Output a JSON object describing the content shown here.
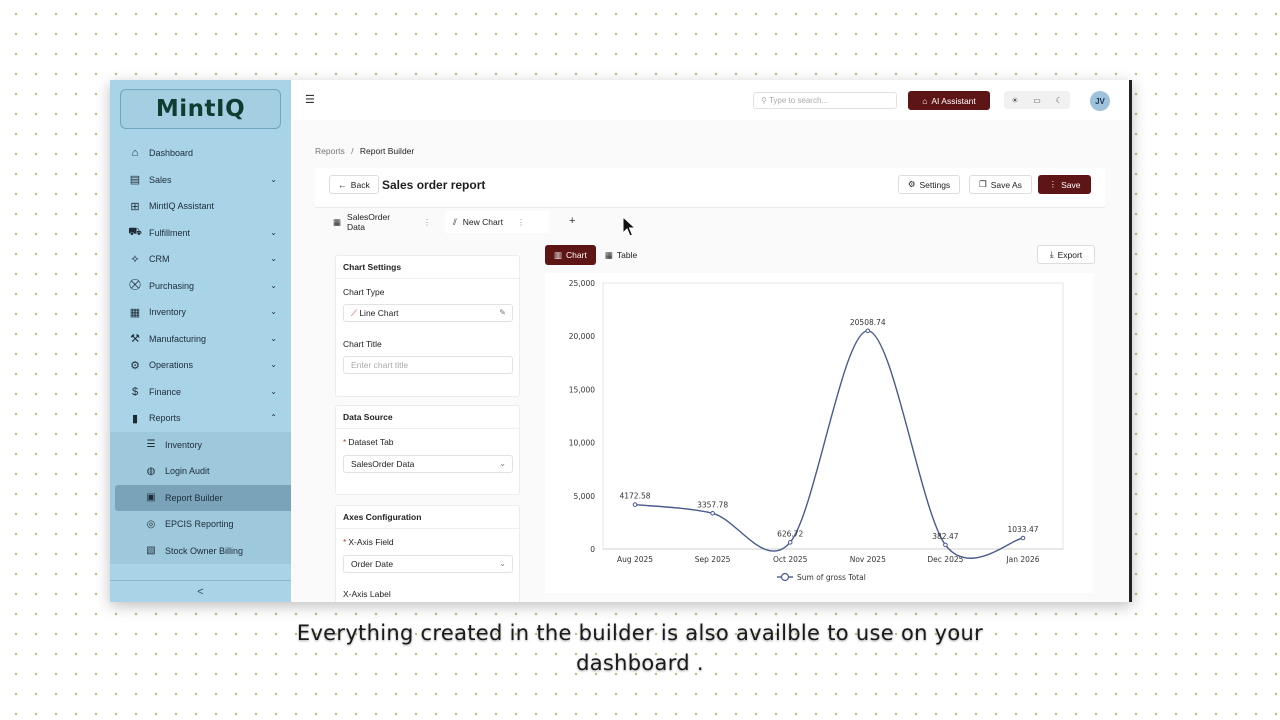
{
  "app": {
    "logo": "MintIQ",
    "search_placeholder": "Type to search...",
    "ai_button": "AI Assistant",
    "avatar_initials": "JV"
  },
  "sidebar": {
    "items": [
      {
        "label": "Dashboard",
        "icon": "home-icon",
        "has_chevron": false
      },
      {
        "label": "Sales",
        "icon": "receipt-icon",
        "has_chevron": true
      },
      {
        "label": "MintIQ Assistant",
        "icon": "assistant-icon",
        "has_chevron": false
      },
      {
        "label": "Fulfillment",
        "icon": "truck-icon",
        "has_chevron": true
      },
      {
        "label": "CRM",
        "icon": "handshake-icon",
        "has_chevron": true
      },
      {
        "label": "Purchasing",
        "icon": "cart-icon",
        "has_chevron": true
      },
      {
        "label": "Inventory",
        "icon": "warehouse-icon",
        "has_chevron": true
      },
      {
        "label": "Manufacturing",
        "icon": "factory-icon",
        "has_chevron": true
      },
      {
        "label": "Operations",
        "icon": "wrench-icon",
        "has_chevron": true
      },
      {
        "label": "Finance",
        "icon": "dollar-icon",
        "has_chevron": true
      },
      {
        "label": "Reports",
        "icon": "bar-chart-icon",
        "has_chevron": true,
        "expanded": true
      }
    ],
    "sub_items": [
      {
        "label": "Inventory",
        "icon": "list-icon"
      },
      {
        "label": "Login Audit",
        "icon": "database-icon"
      },
      {
        "label": "Report Builder",
        "icon": "report-icon",
        "active": true
      },
      {
        "label": "EPCIS Reporting",
        "icon": "target-icon"
      },
      {
        "label": "Stock Owner Billing",
        "icon": "billing-icon"
      }
    ],
    "collapse_label": "<"
  },
  "breadcrumb": {
    "parent": "Reports",
    "separator": "/",
    "current": "Report Builder"
  },
  "header": {
    "back_label": "Back",
    "title": "Sales order report",
    "settings_label": "Settings",
    "save_as_label": "Save As",
    "save_label": "Save"
  },
  "tabs": [
    {
      "label": "SalesOrder Data",
      "icon": "table-icon"
    },
    {
      "label": "New Chart",
      "icon": "chart-icon",
      "active": true
    }
  ],
  "add_tab_label": "+",
  "chart_settings": {
    "heading": "Chart Settings",
    "chart_type_label": "Chart Type",
    "chart_type_value": "Line Chart",
    "chart_title_label": "Chart Title",
    "chart_title_placeholder": "Enter chart title"
  },
  "data_source": {
    "heading": "Data Source",
    "dataset_label": "Dataset Tab",
    "dataset_value": "SalesOrder Data"
  },
  "axes": {
    "heading": "Axes Configuration",
    "x_field_label": "X-Axis Field",
    "x_field_value": "Order Date",
    "x_label_label": "X-Axis Label"
  },
  "view_toggle": {
    "chart_label": "Chart",
    "table_label": "Table"
  },
  "export_label": "Export",
  "chart_data": {
    "type": "line",
    "categories": [
      "Aug 2025",
      "Sep 2025",
      "Oct 2025",
      "Nov 2025",
      "Dec 2025",
      "Jan 2026"
    ],
    "series": [
      {
        "name": "Sum of gross Total",
        "values": [
          4172.58,
          3357.78,
          626.72,
          20508.74,
          382.47,
          1033.47
        ],
        "color": "#4a5a8c"
      }
    ],
    "data_labels": [
      "4172.58",
      "3357.78",
      "626.72",
      "20508.74",
      "382.47",
      "1033.47"
    ],
    "ylim": [
      0,
      25000
    ],
    "yticks": [
      0,
      5000,
      10000,
      15000,
      20000,
      25000
    ],
    "ytick_labels": [
      "0",
      "5,000",
      "10,000",
      "15,000",
      "20,000",
      "25,000"
    ],
    "legend": "bottom",
    "grid": false,
    "title": "",
    "xlabel": "",
    "ylabel": ""
  },
  "caption": {
    "line1": "Everything created in the builder is also availble to use on your",
    "line2": "dashboard ."
  },
  "colors": {
    "accent": "#5e1515",
    "sidebar": "#a9d3e6",
    "series": "#4a5a8c"
  }
}
